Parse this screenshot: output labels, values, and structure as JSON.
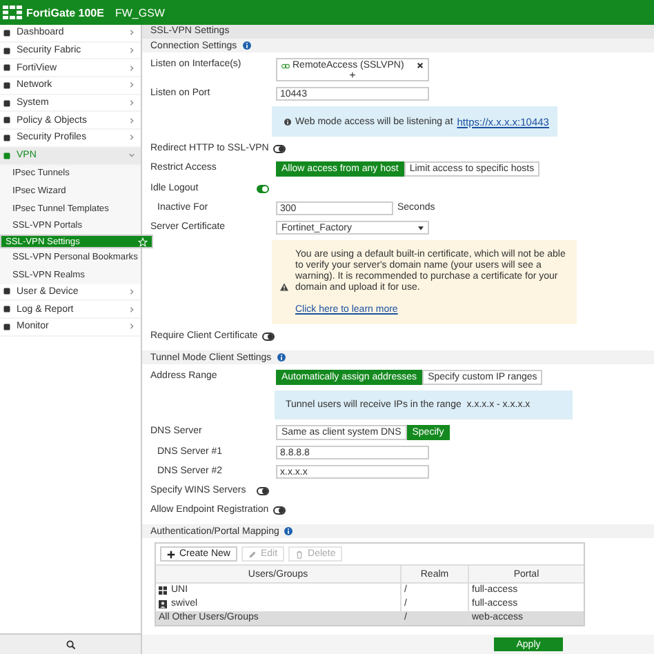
{
  "header": {
    "product": "FortiGate 100E",
    "hostname": "FW_GSW"
  },
  "sidebar": {
    "items": [
      {
        "label": "Dashboard",
        "expanded": false,
        "selected": false
      },
      {
        "label": "Security Fabric",
        "expanded": false,
        "selected": false
      },
      {
        "label": "FortiView",
        "expanded": false,
        "selected": false
      },
      {
        "label": "Network",
        "expanded": false,
        "selected": false
      },
      {
        "label": "System",
        "expanded": false,
        "selected": false
      },
      {
        "label": "Policy & Objects",
        "expanded": false,
        "selected": false
      },
      {
        "label": "Security Profiles",
        "expanded": false,
        "selected": false
      },
      {
        "label": "VPN",
        "expanded": true,
        "selected": false,
        "children": [
          {
            "label": "IPsec Tunnels",
            "selected": false
          },
          {
            "label": "IPsec Wizard",
            "selected": false
          },
          {
            "label": "IPsec Tunnel Templates",
            "selected": false
          },
          {
            "label": "SSL-VPN Portals",
            "selected": false
          },
          {
            "label": "SSL-VPN Settings",
            "selected": true
          },
          {
            "label": "SSL-VPN Personal Bookmarks",
            "selected": false
          },
          {
            "label": "SSL-VPN Realms",
            "selected": false
          }
        ]
      },
      {
        "label": "User & Device",
        "expanded": false,
        "selected": false
      },
      {
        "label": "Log & Report",
        "expanded": false,
        "selected": false
      },
      {
        "label": "Monitor",
        "expanded": false,
        "selected": false
      }
    ]
  },
  "page": {
    "title": "SSL-VPN Settings"
  },
  "sections": [
    {
      "title": "Connection Settings",
      "rows": [
        {
          "kind": "interface",
          "label": "Listen on Interface(s)",
          "value": "RemoteAccess (SSLVPN)",
          "add": "+"
        },
        {
          "kind": "input",
          "label": "Listen on Port",
          "value": "10443"
        },
        {
          "kind": "info",
          "text": "Web mode access will be listening at",
          "link": "https://x.x.x.x:10443"
        },
        {
          "kind": "toggle",
          "label": "Redirect HTTP to SSL-VPN",
          "on": false
        },
        {
          "kind": "choice",
          "label": "Restrict Access",
          "options": [
            {
              "label": "Allow access from any host",
              "selected": true
            },
            {
              "label": "Limit access to specific hosts",
              "selected": false
            }
          ]
        },
        {
          "kind": "toggle",
          "label": "Idle Logout",
          "on": true
        },
        {
          "kind": "subinput",
          "label": "Inactive For",
          "value": "300",
          "unit": "Seconds"
        },
        {
          "kind": "select",
          "label": "Server Certificate",
          "value": "Fortinet_Factory"
        },
        {
          "kind": "warning",
          "text": "You are using a default built-in certificate, which will not be able to verify your server's domain name (your users will see a warning). It is recommended to purchase a certificate for your domain and upload it for use.",
          "link": "Click here to learn more"
        },
        {
          "kind": "toggle",
          "label": "Require Client Certificate",
          "on": false
        }
      ]
    },
    {
      "title": "Tunnel Mode Client Settings",
      "rows": [
        {
          "kind": "choice",
          "label": "Address Range",
          "options": [
            {
              "label": "Automatically assign addresses",
              "selected": true
            },
            {
              "label": "Specify custom IP ranges",
              "selected": false
            }
          ]
        },
        {
          "kind": "note",
          "text": "Tunnel users will receive IPs in the range  x.x.x.x - x.x.x.x"
        },
        {
          "kind": "choice",
          "label": "DNS Server",
          "options": [
            {
              "label": "Same as client system DNS",
              "selected": false
            },
            {
              "label": "Specify",
              "selected": true
            }
          ]
        },
        {
          "kind": "subinput",
          "label": "DNS Server #1",
          "value": "8.8.8.8"
        },
        {
          "kind": "subinput",
          "label": "DNS Server #2",
          "value": "x.x.x.x"
        },
        {
          "kind": "toggle",
          "label": "Specify WINS Servers",
          "on": false
        },
        {
          "kind": "toggle",
          "label": "Allow Endpoint Registration",
          "on": false
        }
      ]
    }
  ],
  "auth": {
    "title": "Authentication/Portal Mapping",
    "toolbar": [
      {
        "kind": "create",
        "label": "Create New",
        "disabled": false
      },
      {
        "kind": "edit",
        "label": "Edit",
        "disabled": true
      },
      {
        "kind": "delete",
        "label": "Delete",
        "disabled": true
      }
    ],
    "columns": [
      "Users/Groups",
      "Realm",
      "Portal"
    ],
    "rows": [
      {
        "kind": "group",
        "users": "UNI",
        "realm": "/",
        "portal": "full-access",
        "selected": false
      },
      {
        "kind": "user",
        "users": "swivel",
        "realm": "/",
        "portal": "full-access",
        "selected": false
      },
      {
        "kind": "none",
        "users": "All Other Users/Groups",
        "realm": "/",
        "portal": "web-access",
        "selected": true
      }
    ]
  },
  "apply": "Apply"
}
